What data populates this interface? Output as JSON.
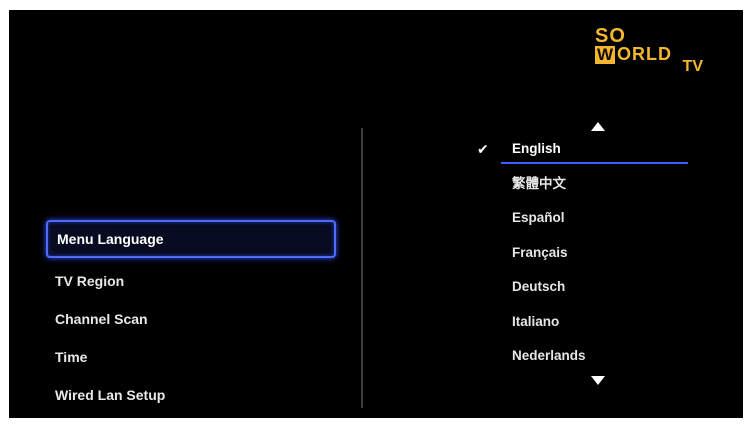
{
  "logo": {
    "line1": "SO",
    "w": "W",
    "line2": "ORLD",
    "line3": "TV"
  },
  "menu": {
    "items": [
      {
        "label": "Menu Language"
      },
      {
        "label": "TV Region"
      },
      {
        "label": "Channel Scan"
      },
      {
        "label": "Time"
      },
      {
        "label": "Wired Lan Setup"
      }
    ],
    "selected": "Menu Language"
  },
  "languages": {
    "items": [
      {
        "label": "English"
      },
      {
        "label": "繁體中文"
      },
      {
        "label": "Español"
      },
      {
        "label": "Français"
      },
      {
        "label": "Deutsch"
      },
      {
        "label": "Italiano"
      },
      {
        "label": "Nederlands"
      }
    ],
    "selected": "English",
    "check_icon": "check-icon",
    "scroll_up_icon": "triangle-up-icon",
    "scroll_down_icon": "triangle-down-icon"
  },
  "colors": {
    "background": "#000000",
    "selection_border": "#4d6cff",
    "logo": "#f2b72f"
  }
}
